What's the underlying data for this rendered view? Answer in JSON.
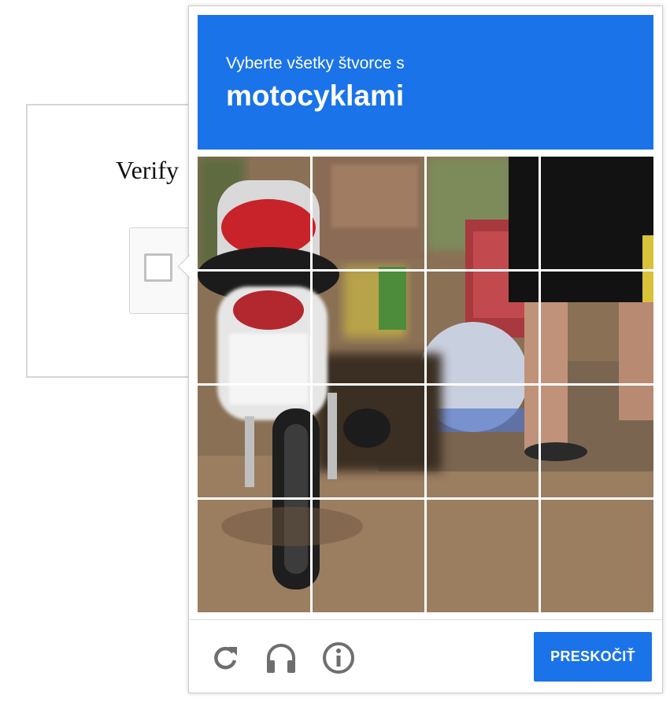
{
  "background_card": {
    "title": "Verify"
  },
  "challenge": {
    "instruction": "Vyberte všetky štvorce s",
    "target": "motocyklami",
    "grid_rows": 4,
    "grid_cols": 4,
    "tile_count": 16,
    "header_color": "#1a73e8"
  },
  "footer": {
    "reload_icon": "reload-icon",
    "audio_icon": "headphones-icon",
    "info_icon": "info-icon",
    "skip_label": "PRESKOČIŤ"
  }
}
